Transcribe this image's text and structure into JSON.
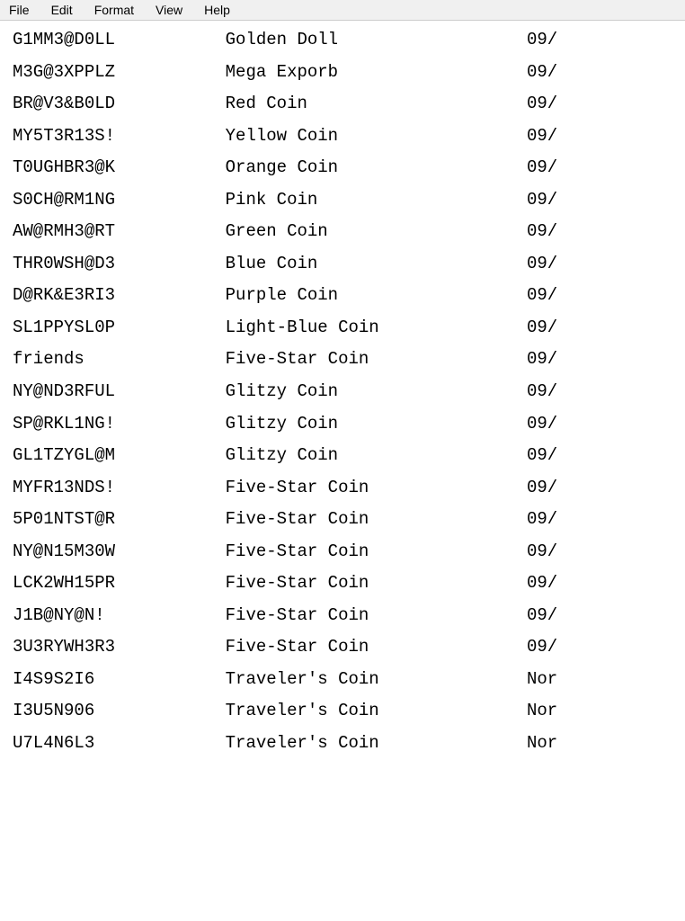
{
  "menu": {
    "items": [
      "File",
      "Edit",
      "Format",
      "View",
      "Help"
    ]
  },
  "table": {
    "rows": [
      {
        "code": "G1MM3@D0LL",
        "name": "Golden Doll",
        "date": "09/"
      },
      {
        "code": "M3G@3XPPLZ",
        "name": "Mega Exporb",
        "date": "09/"
      },
      {
        "code": "BR@V3&B0LD",
        "name": "Red Coin",
        "date": "09/"
      },
      {
        "code": "MY5T3R13S!",
        "name": "Yellow Coin",
        "date": "09/"
      },
      {
        "code": "T0UGHBR3@K",
        "name": "Orange Coin",
        "date": "09/"
      },
      {
        "code": "S0CH@RM1NG",
        "name": "Pink Coin",
        "date": "09/"
      },
      {
        "code": "AW@RMH3@RT",
        "name": "Green Coin",
        "date": "09/"
      },
      {
        "code": "THR0WSH@D3",
        "name": "Blue Coin",
        "date": "09/"
      },
      {
        "code": "D@RK&E3RI3",
        "name": "Purple Coin",
        "date": "09/"
      },
      {
        "code": "SL1PPYSL0P",
        "name": "Light-Blue Coin",
        "date": "09/"
      },
      {
        "code": "friends",
        "name": "Five-Star Coin",
        "date": "09/"
      },
      {
        "code": "NY@ND3RFUL",
        "name": "Glitzy Coin",
        "date": "09/"
      },
      {
        "code": "SP@RKL1NG!",
        "name": "Glitzy Coin",
        "date": "09/"
      },
      {
        "code": "GL1TZYGL@M",
        "name": "Glitzy Coin",
        "date": "09/"
      },
      {
        "code": "MYFR13NDS!",
        "name": "Five-Star Coin",
        "date": "09/"
      },
      {
        "code": "5P01NTST@R",
        "name": "Five-Star Coin",
        "date": "09/"
      },
      {
        "code": "NY@N15M30W",
        "name": "Five-Star Coin",
        "date": "09/"
      },
      {
        "code": "LCK2WH15PR",
        "name": "Five-Star Coin",
        "date": "09/"
      },
      {
        "code": "J1B@NY@N!",
        "name": "Five-Star Coin",
        "date": "09/"
      },
      {
        "code": "3U3RYWH3R3",
        "name": "Five-Star Coin",
        "date": "09/"
      },
      {
        "code": "I4S9S2I6",
        "name": "Traveler's Coin",
        "date": "Nor"
      },
      {
        "code": "I3U5N906",
        "name": "Traveler's Coin",
        "date": "Nor"
      },
      {
        "code": "U7L4N6L3",
        "name": "Traveler's Coin",
        "date": "Nor"
      }
    ]
  }
}
